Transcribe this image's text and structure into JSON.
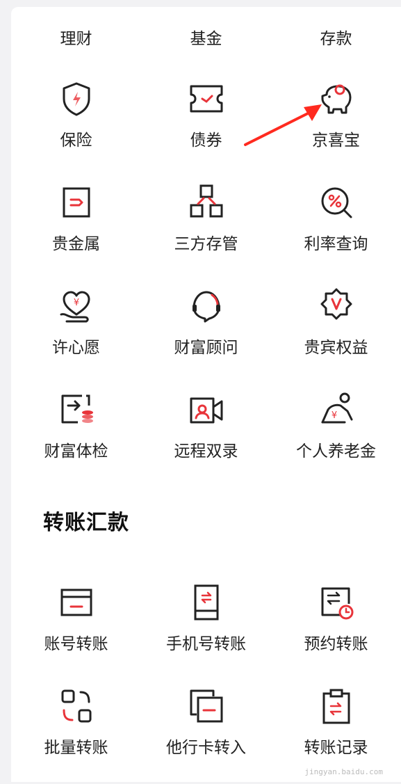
{
  "top_tabs": [
    "理财",
    "基金",
    "存款"
  ],
  "services": [
    {
      "label": "保险",
      "icon": "shield-icon"
    },
    {
      "label": "债券",
      "icon": "ticket-icon"
    },
    {
      "label": "京喜宝",
      "icon": "piggy-bank-icon"
    },
    {
      "label": "贵金属",
      "icon": "gold-bar-icon"
    },
    {
      "label": "三方存管",
      "icon": "custody-blocks-icon"
    },
    {
      "label": "利率查询",
      "icon": "rate-search-icon"
    },
    {
      "label": "许心愿",
      "icon": "wish-heart-icon"
    },
    {
      "label": "财富顾问",
      "icon": "advisor-headset-icon"
    },
    {
      "label": "贵宾权益",
      "icon": "vip-badge-icon"
    },
    {
      "label": "财富体检",
      "icon": "wealth-check-icon"
    },
    {
      "label": "远程双录",
      "icon": "video-record-icon"
    },
    {
      "label": "个人养老金",
      "icon": "pension-icon"
    }
  ],
  "transfer_section": {
    "title": "转账汇款",
    "items": [
      {
        "label": "账号转账",
        "icon": "card-transfer-icon"
      },
      {
        "label": "手机号转账",
        "icon": "phone-transfer-icon"
      },
      {
        "label": "预约转账",
        "icon": "scheduled-transfer-icon"
      },
      {
        "label": "批量转账",
        "icon": "batch-transfer-icon"
      },
      {
        "label": "他行卡转入",
        "icon": "other-bank-card-icon"
      },
      {
        "label": "转账记录",
        "icon": "transfer-record-icon"
      }
    ]
  },
  "watermark": "jingyan.baidu.com",
  "colors": {
    "accent": "#e8343a",
    "icon_stroke": "#222222",
    "arrow": "#ff2a1f"
  }
}
